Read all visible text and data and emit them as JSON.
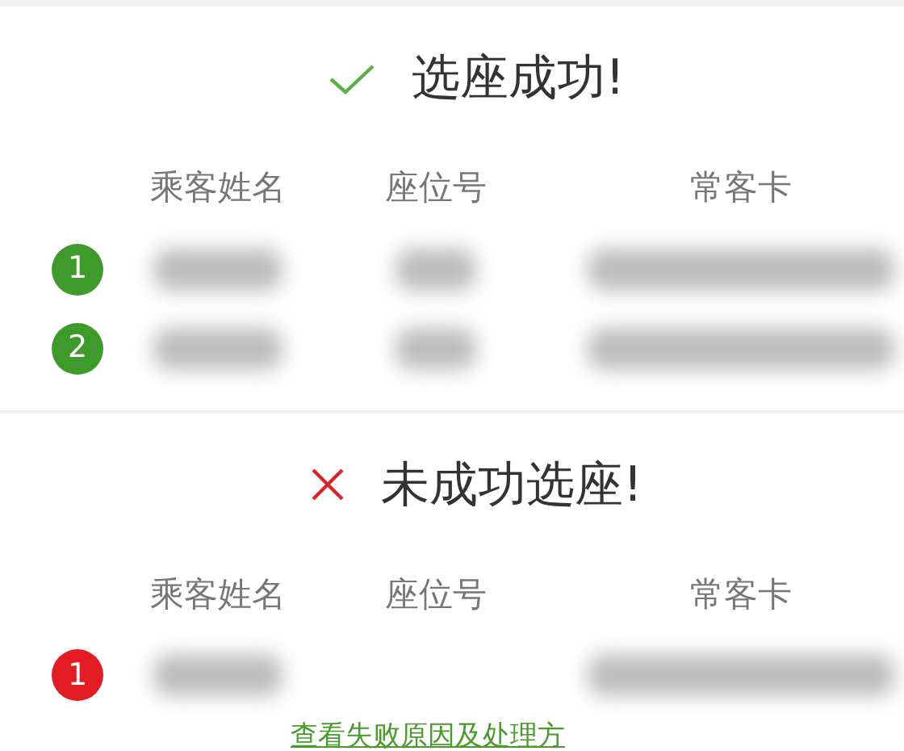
{
  "sections": [
    {
      "kind": "success",
      "title": "选座成功!",
      "columns": [
        "乘客姓名",
        "座位号",
        "常客卡"
      ],
      "passengers": [
        {
          "number": "1",
          "name_redacted": true,
          "seat_redacted": true,
          "card_redacted": true
        },
        {
          "number": "2",
          "name_redacted": true,
          "seat_redacted": true,
          "card_redacted": true
        }
      ]
    },
    {
      "kind": "failure",
      "title": "未成功选座!",
      "columns": [
        "乘客姓名",
        "座位号",
        "常客卡"
      ],
      "passengers": [
        {
          "number": "1",
          "name_redacted": true,
          "seat_redacted": false,
          "card_redacted": true
        }
      ],
      "link": "查看失败原因及处理方"
    }
  ]
}
